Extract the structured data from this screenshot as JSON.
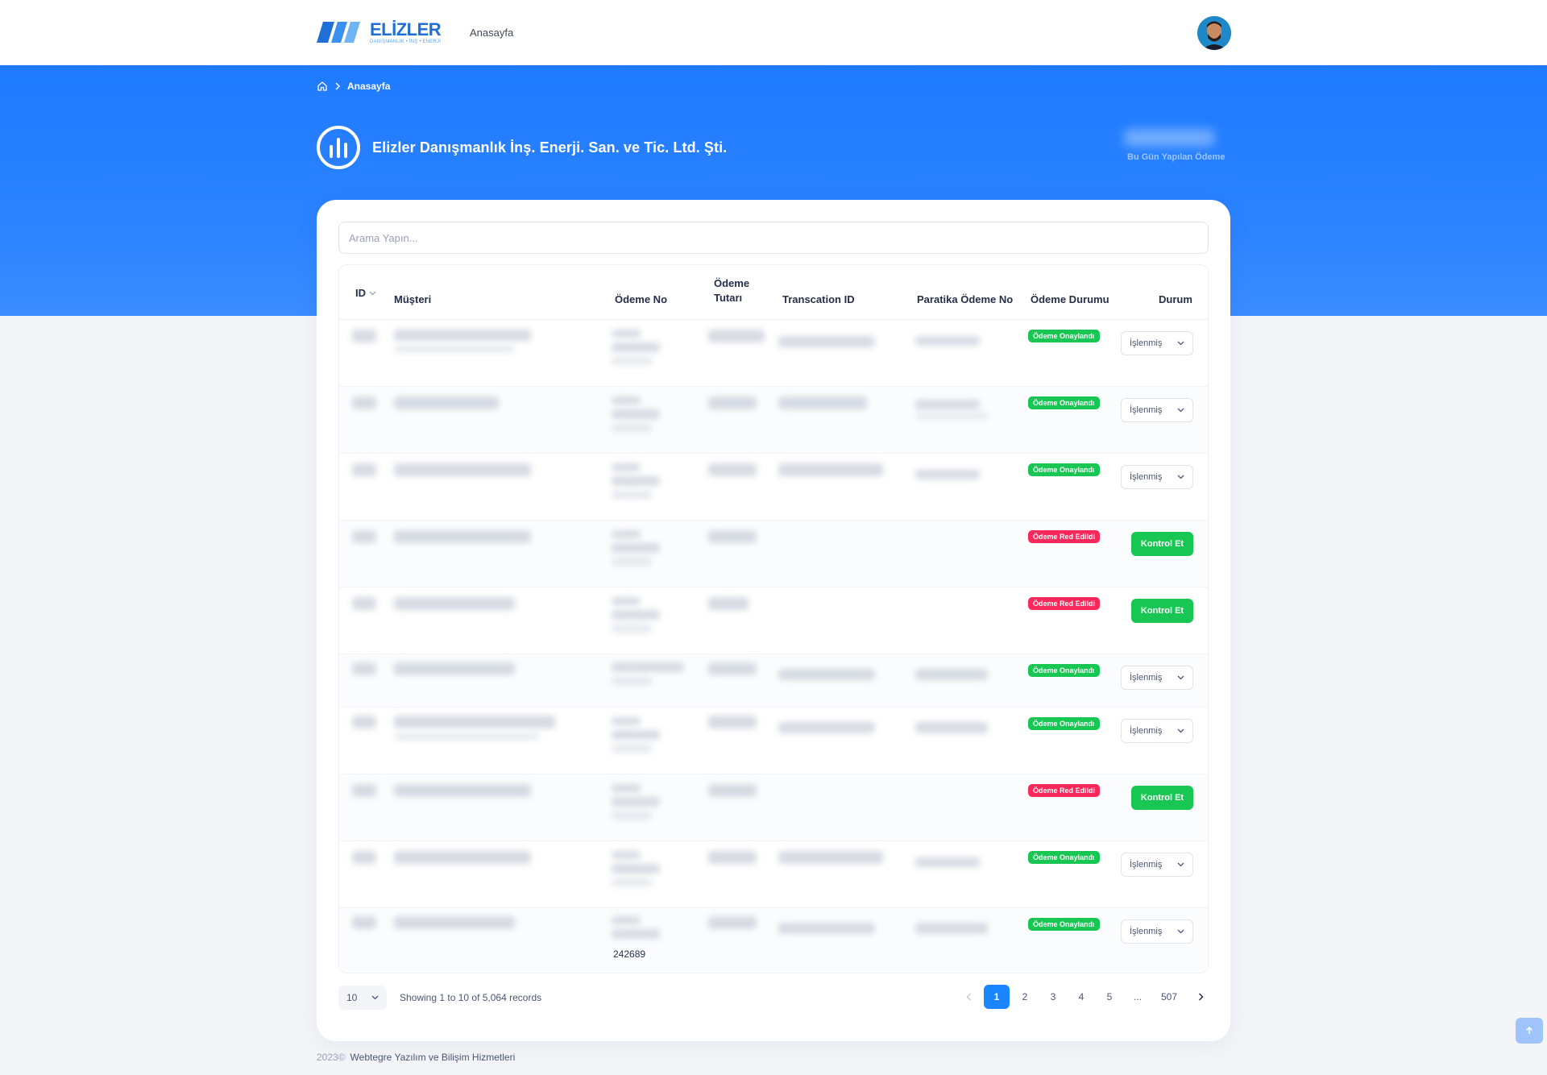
{
  "nav": {
    "logo_name": "ELİZLER",
    "logo_tagline": "DANIŞMANLIK • İNŞ • ENERJİ",
    "home_link": "Anasayfa"
  },
  "hero": {
    "breadcrumb_current": "Anasayfa",
    "company_name": "Elizler Danışmanlık İnş. Enerji. San. ve Tic. Ltd. Şti.",
    "today_label": "Bu Gün Yapılan Ödeme"
  },
  "search": {
    "placeholder": "Arama Yapın..."
  },
  "table": {
    "headers": {
      "id": "ID",
      "customer": "Müşteri",
      "payment_no": "Ödeme No",
      "amount_line1": "Ödeme",
      "amount_line2": "Tutarı",
      "transaction_id": "Transcation ID",
      "paratika_no": "Paratika Ödeme No",
      "payment_status": "Ödeme Durumu",
      "status": "Durum"
    },
    "labels": {
      "approved": "Ödeme Onaylandı",
      "rejected": "Ödeme Red Edildi",
      "processed": "İşlenmiş",
      "check": "Kontrol Et"
    },
    "last_row_payment_no": "242689"
  },
  "footer_controls": {
    "page_size": "10",
    "records_text": "Showing 1 to 10 of 5,064 records",
    "pages": [
      "1",
      "2",
      "3",
      "4",
      "5",
      "...",
      "507"
    ],
    "active_page": "1"
  },
  "footer": {
    "year": "2023©",
    "company": "Webtegre Yazılım ve Bilişim Hizmetleri"
  },
  "colors": {
    "primary": "#1b84ff",
    "hero": "#1f7bff",
    "success": "#17c653",
    "danger": "#f8285a"
  },
  "icons": [
    "home-icon",
    "chevron-right-icon",
    "chevron-down-icon",
    "chevron-left-icon",
    "arrow-up-icon",
    "company-chart-icon"
  ]
}
